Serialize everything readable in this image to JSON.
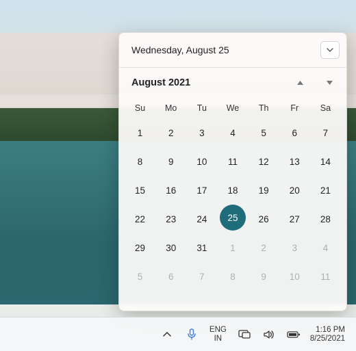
{
  "calendar": {
    "header_date": "Wednesday, August 25",
    "month_label": "August 2021",
    "weekdays": [
      "Su",
      "Mo",
      "Tu",
      "We",
      "Th",
      "Fr",
      "Sa"
    ],
    "weeks": [
      [
        {
          "d": 1
        },
        {
          "d": 2
        },
        {
          "d": 3
        },
        {
          "d": 4
        },
        {
          "d": 5
        },
        {
          "d": 6
        },
        {
          "d": 7
        }
      ],
      [
        {
          "d": 8
        },
        {
          "d": 9
        },
        {
          "d": 10
        },
        {
          "d": 11
        },
        {
          "d": 12
        },
        {
          "d": 13
        },
        {
          "d": 14
        }
      ],
      [
        {
          "d": 15
        },
        {
          "d": 16
        },
        {
          "d": 17
        },
        {
          "d": 18
        },
        {
          "d": 19
        },
        {
          "d": 20
        },
        {
          "d": 21
        }
      ],
      [
        {
          "d": 22
        },
        {
          "d": 23
        },
        {
          "d": 24
        },
        {
          "d": 25,
          "selected": true
        },
        {
          "d": 26
        },
        {
          "d": 27
        },
        {
          "d": 28
        }
      ],
      [
        {
          "d": 29
        },
        {
          "d": 30
        },
        {
          "d": 31
        },
        {
          "d": 1,
          "out": true
        },
        {
          "d": 2,
          "out": true
        },
        {
          "d": 3,
          "out": true
        },
        {
          "d": 4,
          "out": true
        }
      ],
      [
        {
          "d": 5,
          "out": true
        },
        {
          "d": 6,
          "out": true
        },
        {
          "d": 7,
          "out": true
        },
        {
          "d": 8,
          "out": true
        },
        {
          "d": 9,
          "out": true
        },
        {
          "d": 10,
          "out": true
        },
        {
          "d": 11,
          "out": true
        }
      ]
    ]
  },
  "taskbar": {
    "lang_top": "ENG",
    "lang_bottom": "IN",
    "time": "1:16 PM",
    "date": "8/25/2021"
  },
  "colors": {
    "accent": "#1f6d7a"
  }
}
